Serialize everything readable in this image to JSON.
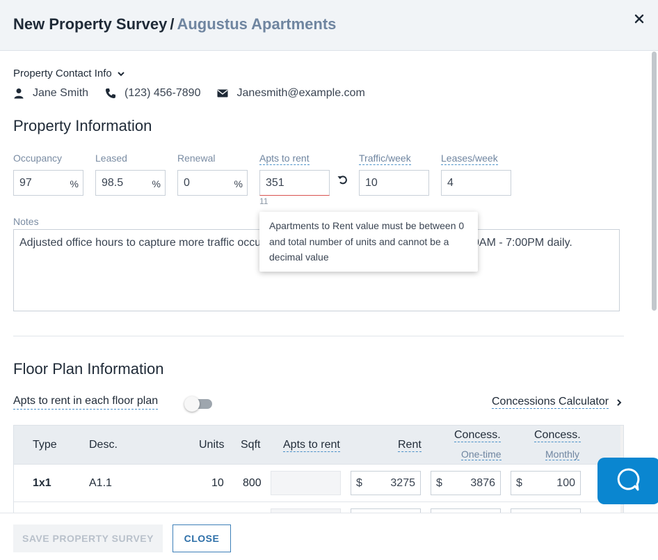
{
  "header": {
    "title": "New Property Survey",
    "separator": "/",
    "subtitle": "Augustus Apartments",
    "close_icon": "close-icon"
  },
  "contact": {
    "toggle_label": "Property Contact Info",
    "name": "Jane Smith",
    "phone": "(123) 456-7890",
    "email": "Janesmith@example.com"
  },
  "property_info": {
    "title": "Property Information",
    "fields": [
      {
        "label": "Occupancy",
        "value": "97",
        "suffix": "%"
      },
      {
        "label": "Leased",
        "value": "98.5",
        "suffix": "%"
      },
      {
        "label": "Renewal",
        "value": "0",
        "suffix": "%"
      },
      {
        "label": "Apts to rent",
        "value": "351",
        "counter": "11"
      },
      {
        "label": "Traffic/week",
        "value": "10"
      },
      {
        "label": "Leases/week",
        "value": "4"
      }
    ],
    "notes_label": "Notes",
    "notes_visible_left": "Adjusted office hours to capture more traffic occu",
    "notes_visible_right": "0AM - 7:00PM daily.",
    "tooltip": "Apartments to Rent value must be between 0 and total number of units and cannot be a decimal value"
  },
  "floor_plan": {
    "title": "Floor Plan Information",
    "toggle_label": "Apts to rent in each floor plan",
    "toggle_on": false,
    "calculator_link": "Concessions Calculator",
    "columns": {
      "type": "Type",
      "desc": "Desc.",
      "units": "Units",
      "sqft": "Sqft",
      "apts": "Apts to rent",
      "rent": "Rent",
      "concess_one": "Concess.",
      "concess_one_sub": "One-time",
      "concess_monthly": "Concess.",
      "concess_monthly_sub": "Monthly"
    },
    "rows": [
      {
        "type": "1x1",
        "desc": "A1.1",
        "units": "10",
        "sqft": "800",
        "apts": "",
        "rent": "3275",
        "concess_one": "3876",
        "concess_monthly": "100",
        "currency": "$"
      }
    ]
  },
  "footer": {
    "save_label": "SAVE PROPERTY SURVEY",
    "close_label": "CLOSE"
  },
  "colors": {
    "accent": "#0a86d0",
    "header_bg": "#f1f4f7",
    "subtitle": "#6f85a0",
    "error": "#d9534f"
  }
}
